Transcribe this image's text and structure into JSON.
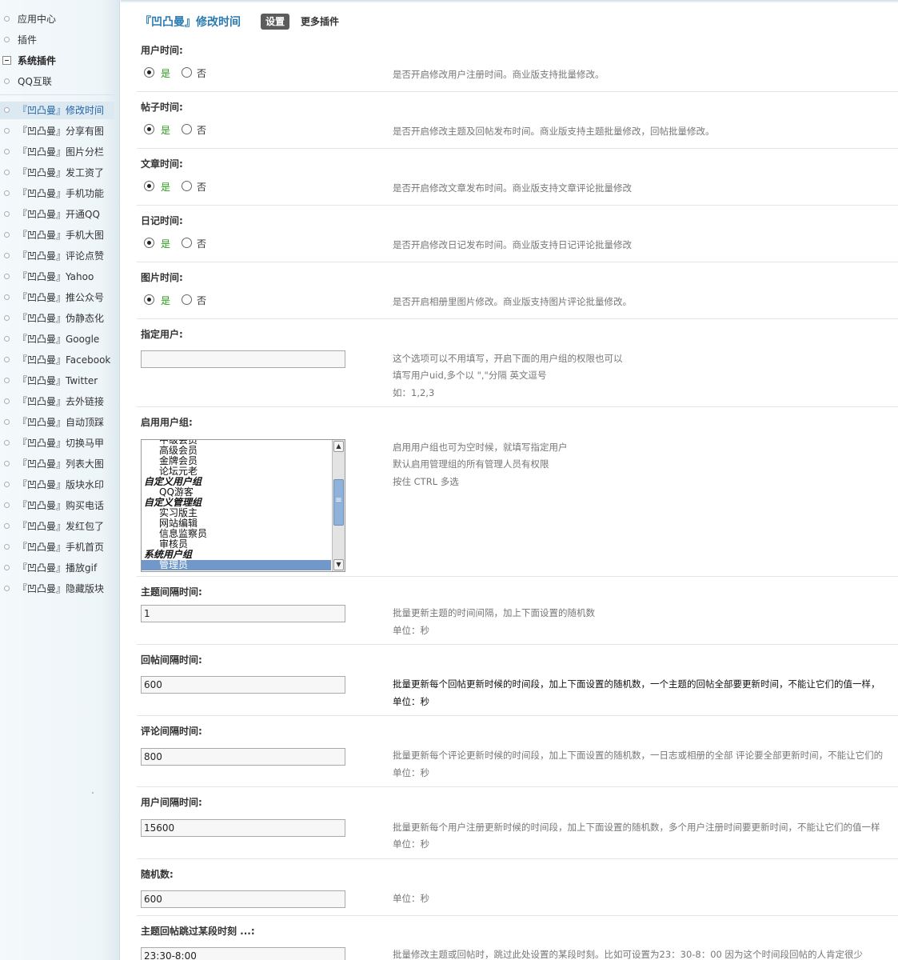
{
  "sidebar": {
    "top_items": [
      "应用中心",
      "插件"
    ],
    "group_label": "系统插件",
    "qq_item": "QQ互联",
    "active_item": "『凹凸曼』修改时间",
    "plugin_items": [
      "『凹凸曼』分享有图",
      "『凹凸曼』图片分栏",
      "『凹凸曼』发工资了",
      "『凹凸曼』手机功能",
      "『凹凸曼』开通QQ",
      "『凹凸曼』手机大图",
      "『凹凸曼』评论点赞",
      "『凹凸曼』Yahoo",
      "『凹凸曼』推公众号",
      "『凹凸曼』伪静态化",
      "『凹凸曼』Google",
      "『凹凸曼』Facebook",
      "『凹凸曼』Twitter",
      "『凹凸曼』去外链接",
      "『凹凸曼』自动顶踩",
      "『凹凸曼』切换马甲",
      "『凹凸曼』列表大图",
      "『凹凸曼』版块水印",
      "『凹凸曼』购买电话",
      "『凹凸曼』发红包了",
      "『凹凸曼』手机首页",
      "『凹凸曼』播放gif",
      "『凹凸曼』隐藏版块"
    ]
  },
  "header": {
    "title": "『凹凸曼』修改时间",
    "tab_settings": "设置",
    "tab_more": "更多插件"
  },
  "radio_labels": {
    "yes": "是",
    "no": "否"
  },
  "settings": {
    "user_time": {
      "label": "用户时间:",
      "value": "是",
      "desc": "是否开启修改用户注册时间。商业版支持批量修改。"
    },
    "post_time": {
      "label": "帖子时间:",
      "value": "是",
      "desc": "是否开启修改主题及回帖发布时间。商业版支持主题批量修改，回帖批量修改。"
    },
    "article_time": {
      "label": "文章时间:",
      "value": "是",
      "desc": "是否开启修改文章发布时间。商业版支持文章评论批量修改"
    },
    "diary_time": {
      "label": "日记时间:",
      "value": "是",
      "desc": "是否开启修改日记发布时间。商业版支持日记评论批量修改"
    },
    "photo_time": {
      "label": "图片时间:",
      "value": "是",
      "desc": "是否开启相册里图片修改。商业版支持图片评论批量修改。"
    },
    "specified_users": {
      "label": "指定用户:",
      "value": "",
      "desc": [
        "这个选项可以不用填写，开启下面的用户组的权限也可以",
        "填写用户uid,多个以 \",\"分隔 英文逗号",
        "如：1,2,3"
      ]
    },
    "enabled_groups": {
      "label": "启用用户组:",
      "options": [
        {
          "text": "中级会员",
          "kind": "child"
        },
        {
          "text": "高级会员",
          "kind": "child"
        },
        {
          "text": "金牌会员",
          "kind": "child"
        },
        {
          "text": "论坛元老",
          "kind": "child"
        },
        {
          "text": "自定义用户组",
          "kind": "head"
        },
        {
          "text": "QQ游客",
          "kind": "child"
        },
        {
          "text": "自定义管理组",
          "kind": "head"
        },
        {
          "text": "实习版主",
          "kind": "child"
        },
        {
          "text": "网站编辑",
          "kind": "child"
        },
        {
          "text": "信息监察员",
          "kind": "child"
        },
        {
          "text": "审核员",
          "kind": "child"
        },
        {
          "text": "系统用户组",
          "kind": "head"
        },
        {
          "text": "管理员",
          "kind": "child",
          "selected": true
        }
      ],
      "desc": [
        "启用用户组也可为空时候，就填写指定用户",
        "默认启用管理组的所有管理人员有权限",
        "按住 CTRL 多选"
      ]
    },
    "topic_interval": {
      "label": "主题间隔时间:",
      "value": "1",
      "desc": [
        "批量更新主题的时间间隔，加上下面设置的随机数",
        "单位：秒"
      ]
    },
    "reply_interval": {
      "label": "回帖间隔时间:",
      "value": "600",
      "desc": [
        "批量更新每个回帖更新时候的时间段，加上下面设置的随机数，一个主题的回帖全部要更新时间，不能让它们的值一样，",
        "单位：秒"
      ]
    },
    "comment_interval": {
      "label": "评论间隔时间:",
      "value": "800",
      "desc": [
        "批量更新每个评论更新时候的时间段，加上下面设置的随机数，一日志或相册的全部 评论要全部更新时间，不能让它们的",
        "单位：秒"
      ]
    },
    "user_interval": {
      "label": "用户间隔时间:",
      "value": "15600",
      "desc": [
        "批量更新每个用户注册更新时候的时间段，加上下面设置的随机数，多个用户注册时间要更新时间，不能让它们的值一样",
        "单位：秒"
      ]
    },
    "random_number": {
      "label": "随机数:",
      "value": "600",
      "desc": "单位：秒"
    },
    "skip_period": {
      "label": "主题回帖跳过某段时刻 ...:",
      "value": "23:30-8:00",
      "desc": "批量修改主题或回帖时，跳过此处设置的某段时刻。比如可设置为23：30-8：00 因为这个时间段回帖的人肯定很少"
    }
  }
}
